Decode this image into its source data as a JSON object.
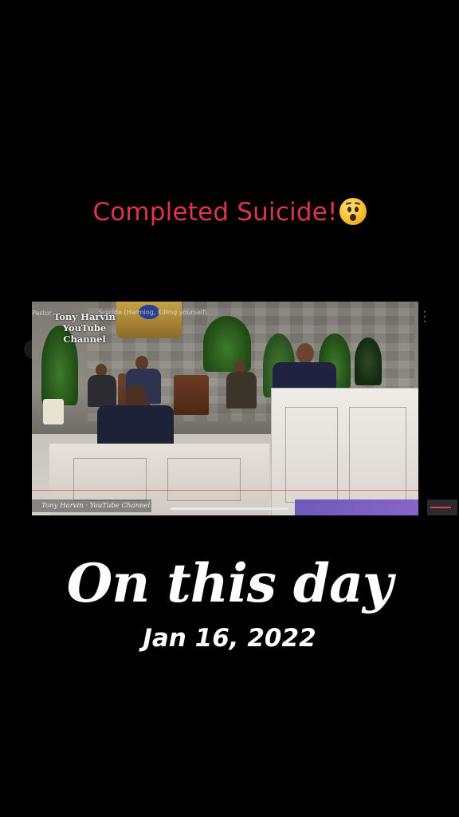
{
  "caption": {
    "text": "Completed Suicide!",
    "emoji": "astonished-face"
  },
  "video": {
    "overlay_title_line1": "Tony Harvin",
    "overlay_title_line2": "YouTube",
    "overlay_title_line3": "Channel",
    "video_title_fragment": "Suicide (Harming, Killing yourself)",
    "channel_label": "Pastor",
    "footer_channel": "Tony Harvin · YouTube Channel"
  },
  "headline": "On this day",
  "date": "Jan 16, 2022",
  "colors": {
    "caption": "#e0344d",
    "background": "#000000"
  }
}
